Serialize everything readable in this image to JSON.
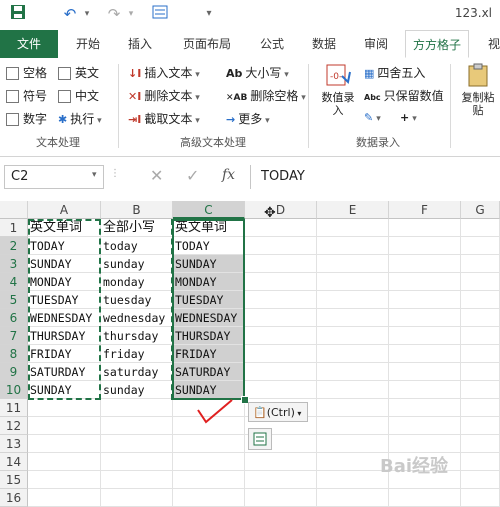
{
  "window": {
    "doc_title": "123.xl"
  },
  "tabs": [
    "文件",
    "开始",
    "插入",
    "页面布局",
    "公式",
    "数据",
    "审阅",
    "方方格子",
    "视"
  ],
  "ribbon": {
    "text_group": {
      "checkboxes": [
        "空格",
        "英文",
        "符号",
        "中文",
        "数字"
      ],
      "execute_label": "执行",
      "group_label": "文本处理"
    },
    "advanced_group": {
      "insert_text": "插入文本",
      "delete_text": "删除文本",
      "cut_text": "截取文本",
      "case_label": "大小写",
      "delete_space": "删除空格",
      "more_label": "更多",
      "group_label": "高级文本处理"
    },
    "number_group": {
      "value_entry": "数值录入",
      "round_label": "四舍五入",
      "keep_value": "只保留数值",
      "group_label": "数据录入"
    },
    "copy_paste": "复制粘贴"
  },
  "formula_bar": {
    "name_box": "C2",
    "fx": "fx",
    "formula": "TODAY"
  },
  "grid": {
    "columns": [
      "A",
      "B",
      "C",
      "D",
      "E",
      "F",
      "G"
    ],
    "rows": [
      "1",
      "2",
      "3",
      "4",
      "5",
      "6",
      "7",
      "8",
      "9",
      "10",
      "11",
      "12",
      "13",
      "14",
      "15",
      "16"
    ],
    "col_a": [
      "英文单词",
      "TODAY",
      "SUNDAY",
      "MONDAY",
      "TUESDAY",
      "WEDNESDAY",
      "THURSDAY",
      "FRIDAY",
      "SATURDAY",
      "SUNDAY"
    ],
    "col_b": [
      "全部小写",
      "today",
      "sunday",
      "monday",
      "tuesday",
      "wednesday",
      "thursday",
      "friday",
      "saturday",
      "sunday"
    ],
    "col_c": [
      "英文单词",
      "TODAY",
      "SUNDAY",
      "MONDAY",
      "TUESDAY",
      "WEDNESDAY",
      "THURSDAY",
      "FRIDAY",
      "SATURDAY",
      "SUNDAY"
    ]
  },
  "paste_options": {
    "label": "(Ctrl)"
  },
  "watermark": "Bai经验"
}
